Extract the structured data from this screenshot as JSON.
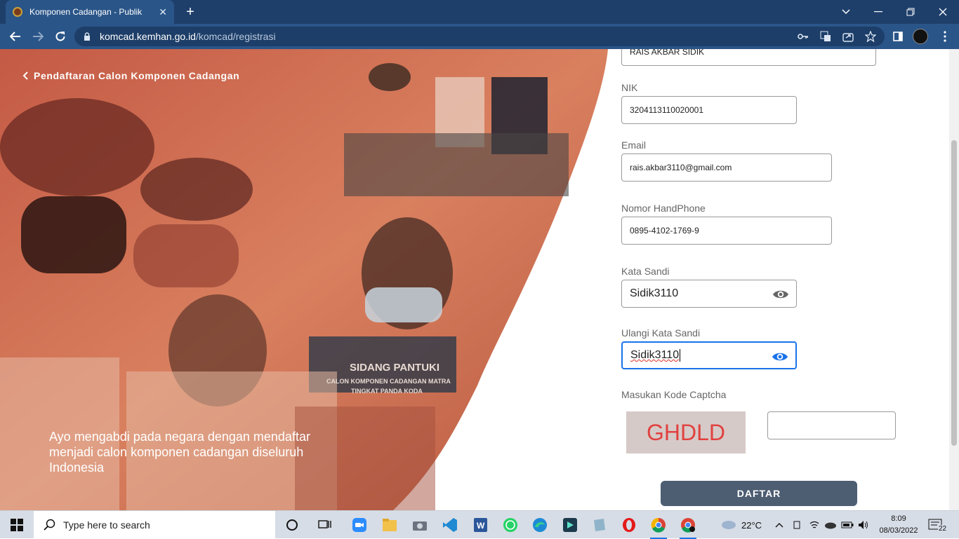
{
  "browser": {
    "tab_title": "Komponen Cadangan - Publik",
    "url_host": "komcad.kemhan.go.id",
    "url_path": "/komcad/registrasi"
  },
  "hero": {
    "back_label": "Pendaftaran Calon Komponen Cadangan",
    "tagline": "Ayo mengabdi pada negara dengan mendaftar menjadi calon komponen cadangan diseluruh Indonesia",
    "banner_line1": "SIDANG PANTUKI",
    "banner_line2": "CALON KOMPONEN CADANGAN MATRA",
    "banner_line3": "TINGKAT PANDA KODA"
  },
  "form": {
    "name_value": "RAIS AKBAR SIDIK",
    "nik_label": "NIK",
    "nik_value": "3204113110020001",
    "email_label": "Email",
    "email_value": "rais.akbar3110@gmail.com",
    "phone_label": "Nomor HandPhone",
    "phone_value": "0895-4102-1769-9",
    "password_label": "Kata Sandi",
    "password_value": "Sidik3110",
    "confirm_label": "Ulangi Kata Sandi",
    "confirm_value": "Sidik3110",
    "captcha_label": "Masukan Kode Captcha",
    "captcha_code": "GHDLD",
    "captcha_input": "",
    "submit_label": "DAFTAR"
  },
  "taskbar": {
    "search_placeholder": "Type here to search",
    "temperature": "22°C",
    "time": "8:09",
    "date": "08/03/2022",
    "notification_count": "22"
  },
  "colors": {
    "chrome_dark": "#1f3f6b",
    "chrome_light": "#2a5588",
    "hero_tint": "#d2735a",
    "button_bg": "#4d5d72",
    "focus_blue": "#1a73e8",
    "captcha_text": "#e0413f"
  }
}
